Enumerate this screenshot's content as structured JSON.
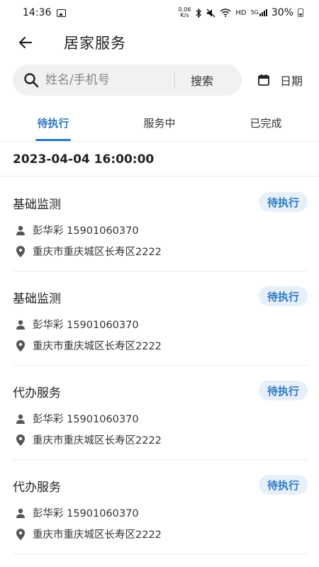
{
  "status_bar": {
    "time": "14:36",
    "net_speed_value": "0.06",
    "net_speed_unit": "K/s",
    "hd_label": "HD",
    "signal_label": "5G",
    "battery": "30%"
  },
  "header": {
    "title": "居家服务"
  },
  "search": {
    "placeholder": "姓名/手机号",
    "value": "",
    "button_label": "搜索",
    "date_label": "日期"
  },
  "tabs": [
    {
      "label": "待执行",
      "active": true
    },
    {
      "label": "服务中",
      "active": false
    },
    {
      "label": "已完成",
      "active": false
    }
  ],
  "date_group": "2023-04-04 16:00:00",
  "cards": [
    {
      "title": "基础监测",
      "status": "待执行",
      "person": "彭华彩 15901060370",
      "address": "重庆市重庆城区长寿区2222"
    },
    {
      "title": "基础监测",
      "status": "待执行",
      "person": "彭华彩 15901060370",
      "address": "重庆市重庆城区长寿区2222"
    },
    {
      "title": "代办服务",
      "status": "待执行",
      "person": "彭华彩 15901060370",
      "address": "重庆市重庆城区长寿区2222"
    },
    {
      "title": "代办服务",
      "status": "待执行",
      "person": "彭华彩 15901060370",
      "address": "重庆市重庆城区长寿区2222"
    }
  ],
  "colors": {
    "accent": "#2f79c4",
    "badge_bg": "#e7f0fa",
    "search_bg": "#f1f1f3"
  }
}
